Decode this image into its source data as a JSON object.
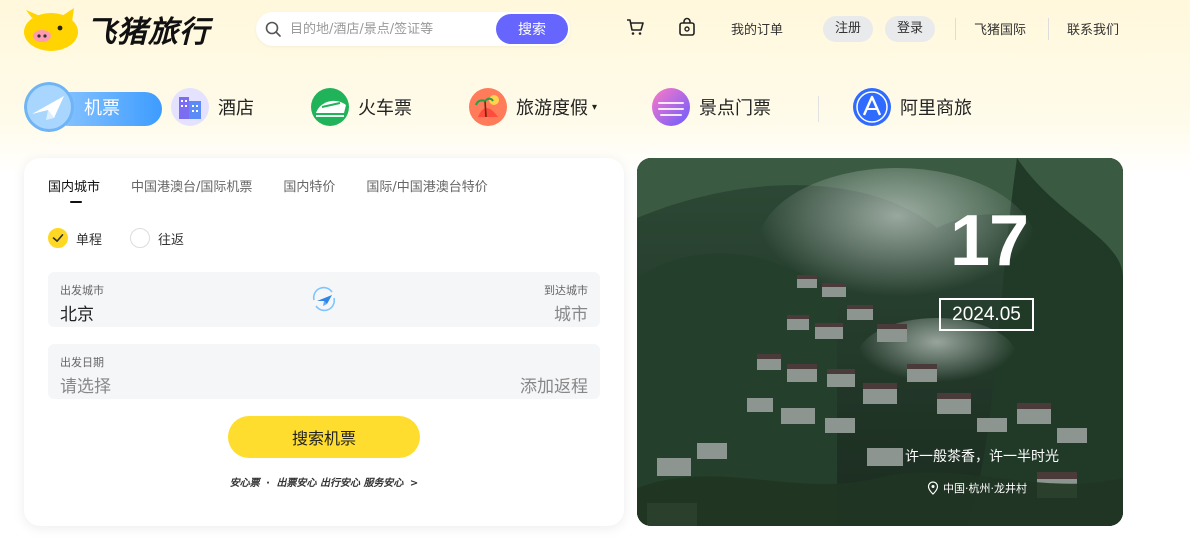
{
  "header": {
    "logo_text": "飞猪旅行",
    "search_placeholder": "目的地/酒店/景点/签证等",
    "search_button": "搜索",
    "cart_icon": "cart-icon",
    "bag_icon": "bag-icon",
    "my_orders": "我的订单",
    "register": "注册",
    "login": "登录",
    "international": "飞猪国际",
    "contact": "联系我们"
  },
  "nav": {
    "items": [
      {
        "label": "机票",
        "icon": "plane-icon",
        "active": true
      },
      {
        "label": "酒店",
        "icon": "hotel-icon"
      },
      {
        "label": "火车票",
        "icon": "train-icon"
      },
      {
        "label": "旅游度假",
        "icon": "vacation-icon",
        "caret": "▾"
      },
      {
        "label": "景点门票",
        "icon": "ticket-icon"
      },
      {
        "label": "阿里商旅",
        "icon": "business-travel-icon"
      }
    ]
  },
  "flight": {
    "tabs": [
      "国内城市",
      "中国港澳台/国际机票",
      "国内特价",
      "国际/中国港澳台特价"
    ],
    "trip_types": [
      "单程",
      "往返"
    ],
    "from_label": "出发城市",
    "from_value": "北京",
    "to_label": "到达城市",
    "to_placeholder": "城市",
    "date_label": "出发日期",
    "date_placeholder": "请选择",
    "return_link": "添加返程",
    "search_button": "搜索机票",
    "assurance": {
      "title": "安心票",
      "items": [
        "出票安心",
        "出行安心",
        "服务安心"
      ],
      "arrow": ">"
    }
  },
  "photo": {
    "day": "17",
    "year_month": "2024.05",
    "slogan": "许一般茶香，许一半时光",
    "location": "中国·杭州·龙井村"
  },
  "colors": {
    "accent_purple": "#6666ff",
    "accent_yellow": "#ffdd2e",
    "active_blue": "#3d9cff"
  }
}
